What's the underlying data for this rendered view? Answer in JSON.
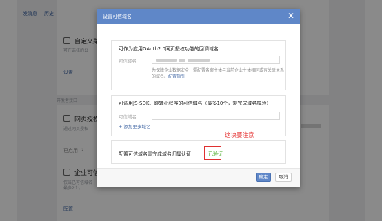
{
  "background": {
    "tabs": [
      "发消息",
      "历史"
    ],
    "section1_title": "自定义菜",
    "section1_desc": "可在选择的公",
    "section1_link": "设置",
    "group_label": "开发者接口",
    "section2_title": "网页授权",
    "section2_desc": "通过网页授权",
    "section2_status": "已启用",
    "section2_chevron": "›",
    "section3_title": "企业可信",
    "section3_desc": "仅当已可信域名",
    "section3_desc2": "最多2个。",
    "section3_link": "配置"
  },
  "dialog": {
    "title": "设置可信域名",
    "close_glyph": "✕",
    "oauth": {
      "title": "可作为应用OAuth2.0网页授权功能的回调域名",
      "field_label": "可信域名",
      "desc_line1": "为保障企业数据安全，需配置备案主体与当前企业主体相同或有关联关系",
      "desc_line2": "的域名。",
      "desc_link": "配置指引"
    },
    "jssdk": {
      "title": "可调用JS-SDK、跳转小程序的可信域名（最多10个，需完成域名校验）",
      "field_label": "可信域名",
      "add_link": "+ 添加更多域名"
    },
    "ownership": {
      "title": "配置可信域名需完成域名归属认证",
      "status": "已验证"
    },
    "annotation": "这块要注意",
    "buttons": {
      "ok": "确定",
      "cancel": "取消"
    }
  },
  "colors": {
    "header_blue": "#5f87c8",
    "verified_green": "#3fa51c",
    "annotation_red": "#e63b3b"
  }
}
